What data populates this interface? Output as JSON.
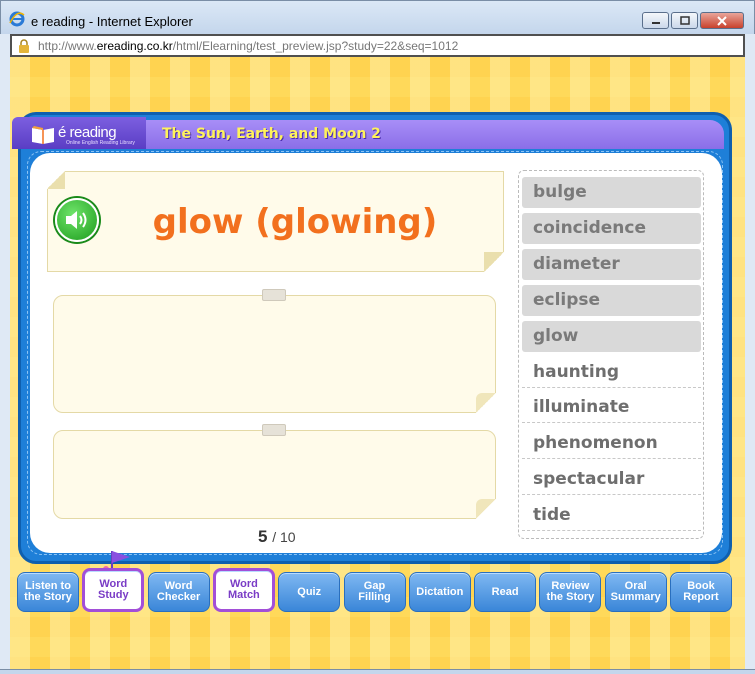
{
  "window": {
    "title": "e reading - Internet Explorer",
    "url_prefix": "http://www.",
    "url_domain": "ereading.co.kr",
    "url_path": "/html/Elearning/test_preview.jsp?study=22&seq=1012"
  },
  "header": {
    "logo_text": "é reading",
    "logo_subtext": "Online English Reading Library",
    "book_title": "The Sun, Earth, and Moon 2"
  },
  "word_card": {
    "word": "glow (glowing)"
  },
  "counter": {
    "current": "5",
    "total": "/ 10"
  },
  "word_list": [
    {
      "label": "bulge",
      "state": "used"
    },
    {
      "label": "coincidence",
      "state": "used"
    },
    {
      "label": "diameter",
      "state": "used"
    },
    {
      "label": "eclipse",
      "state": "used"
    },
    {
      "label": "glow",
      "state": "used"
    },
    {
      "label": "haunting",
      "state": "free"
    },
    {
      "label": "illuminate",
      "state": "free"
    },
    {
      "label": "phenomenon",
      "state": "free"
    },
    {
      "label": "spectacular",
      "state": "free"
    },
    {
      "label": "tide",
      "state": "free"
    }
  ],
  "nav": [
    {
      "line1": "Listen to",
      "line2": "the Story",
      "active": false
    },
    {
      "line1": "Word",
      "line2": "Study",
      "active": true
    },
    {
      "line1": "Word",
      "line2": "Checker",
      "active": false
    },
    {
      "line1": "Word",
      "line2": "Match",
      "active": true
    },
    {
      "line1": "Quiz",
      "line2": "",
      "active": false
    },
    {
      "line1": "Gap",
      "line2": "Filling",
      "active": false
    },
    {
      "line1": "Dictation",
      "line2": "",
      "active": false
    },
    {
      "line1": "Read",
      "line2": "",
      "active": false
    },
    {
      "line1": "Review",
      "line2": "the Story",
      "active": false
    },
    {
      "line1": "Oral",
      "line2": "Summary",
      "active": false
    },
    {
      "line1": "Book",
      "line2": "Report",
      "active": false
    }
  ],
  "colors": {
    "accent_word": "#f2701e",
    "title_yellow": "#fff35a",
    "board_blue": "#1e7fd8",
    "header_purple": "#8a6ee8"
  }
}
